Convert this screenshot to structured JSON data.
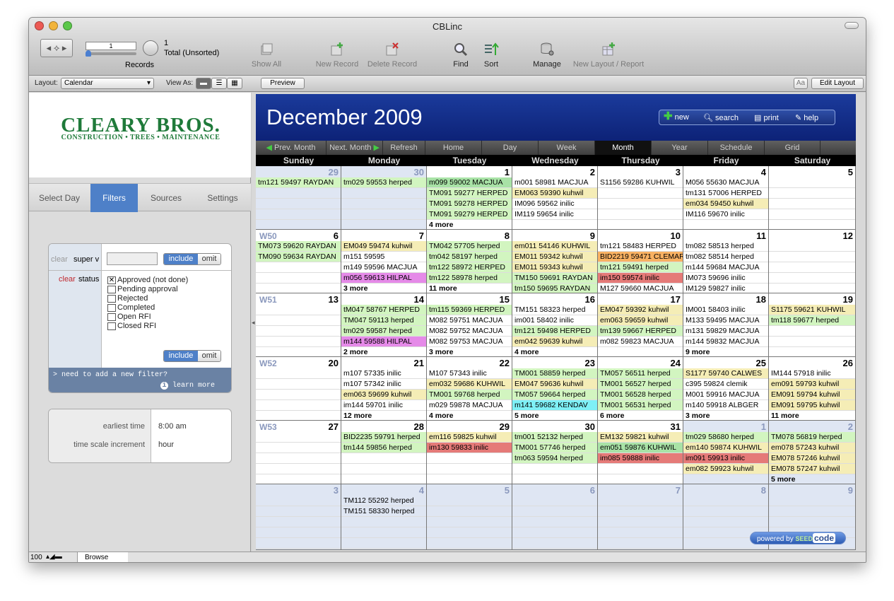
{
  "window": {
    "title": "CBLinc",
    "traffic_lights": [
      "#ec5a54",
      "#f2b43a",
      "#5bc84a"
    ]
  },
  "toolbar": {
    "record_number": "1",
    "found_count": "1",
    "found_label": "Total (Unsorted)",
    "records_label": "Records",
    "show_all": "Show All",
    "new_record": "New Record",
    "delete_record": "Delete Record",
    "find": "Find",
    "sort": "Sort",
    "manage": "Manage",
    "new_layout": "New Layout / Report"
  },
  "layoutbar": {
    "layout_label": "Layout:",
    "layout_value": "Calendar",
    "view_as_label": "View As:",
    "preview": "Preview",
    "aa": "Aa",
    "edit_layout": "Edit Layout"
  },
  "sidebar": {
    "logo_main": "CLEARY BROS.",
    "logo_sub": "CONSTRUCTION • TREES • MAINTENANCE",
    "tabs": [
      "Select Day",
      "Filters",
      "Sources",
      "Settings"
    ],
    "active_tab": "Filters",
    "filter": {
      "clear1": "clear",
      "field1": "super v",
      "clear2": "clear",
      "field2": "status",
      "include": "include",
      "omit": "omit",
      "statuses": [
        "Approved (not done)",
        "Pending approval",
        "Rejected",
        "Completed",
        "Open RFI",
        "Closed RFI"
      ],
      "checked": [
        true,
        false,
        false,
        false,
        false,
        false
      ],
      "need_filter": "> need to add a new filter?",
      "learn_more": "learn more"
    },
    "time": {
      "earliest_label": "earliest time",
      "earliest_value": "8:00 am",
      "scale_label": "time scale increment",
      "scale_value": "hour"
    }
  },
  "statusbar": {
    "zoom": "100",
    "mode": "Browse"
  },
  "calendar": {
    "title": "December 2009",
    "actions": [
      "new",
      "search",
      "print",
      "help"
    ],
    "nav": [
      "Prev. Month",
      "Next. Month",
      "Refresh",
      "Home",
      "Day",
      "Week",
      "Month",
      "Year",
      "Schedule",
      "Grid"
    ],
    "active_view": "Month",
    "weekdays": [
      "Sunday",
      "Monday",
      "Tuesday",
      "Wednesday",
      "Thursday",
      "Friday",
      "Saturday"
    ],
    "weeks": [
      {
        "label": "",
        "days": [
          {
            "n": "29",
            "other": true,
            "ev": [
              [
                "tm121 59497 RAYDAN",
                "g"
              ]
            ]
          },
          {
            "n": "30",
            "other": true,
            "ev": [
              [
                "tm029 59553 herped",
                "g"
              ]
            ]
          },
          {
            "n": "1",
            "ev": [
              [
                "m099 59002 MACJUA",
                "dg"
              ],
              [
                "TM091 59277 HERPED",
                "g"
              ],
              [
                "TM091 59278 HERPED",
                "g"
              ],
              [
                "TM091 59279 HERPED",
                "g"
              ],
              [
                "4 more",
                "m"
              ]
            ]
          },
          {
            "n": "2",
            "ev": [
              [
                "m001 58981 MACJUA",
                ""
              ],
              [
                "EM063 59390 kuhwil",
                "y"
              ],
              [
                "IM096 59562 inilic",
                ""
              ],
              [
                "IM119 59654 inilic",
                ""
              ]
            ]
          },
          {
            "n": "3",
            "ev": [
              [
                "S1156 59286 KUHWIL",
                ""
              ]
            ]
          },
          {
            "n": "4",
            "ev": [
              [
                "M056 55630 MACJUA",
                ""
              ],
              [
                "tm131 57006 HERPED",
                ""
              ],
              [
                "em034 59450 kuhwil",
                "y"
              ],
              [
                "IM116 59670 inilic",
                ""
              ]
            ]
          },
          {
            "n": "5",
            "ev": []
          }
        ]
      },
      {
        "label": "W50",
        "days": [
          {
            "n": "6",
            "ev": [
              [
                "TM073 59620 RAYDAN",
                "g"
              ],
              [
                "TM090 59634 RAYDAN",
                "g"
              ]
            ]
          },
          {
            "n": "7",
            "ev": [
              [
                "EM049 59474 kuhwil",
                "y"
              ],
              [
                "m151 59595",
                ""
              ],
              [
                "m149 59596 MACJUA",
                ""
              ],
              [
                "m056 59613 HILPAL",
                "p"
              ],
              [
                "3 more",
                "m"
              ]
            ]
          },
          {
            "n": "8",
            "ev": [
              [
                "TM042 57705 herped",
                "g"
              ],
              [
                "tm042 58197 herped",
                "g"
              ],
              [
                "tm122 58972 HERPED",
                "g"
              ],
              [
                "tm122 58978 herped",
                "g"
              ],
              [
                "11 more",
                "m"
              ]
            ]
          },
          {
            "n": "9",
            "ev": [
              [
                "em011 54146 KUHWIL",
                "y"
              ],
              [
                "EM011 59342 kuhwil",
                "y"
              ],
              [
                "EM011 59343 kuhwil",
                "y"
              ],
              [
                "TM150 59691 RAYDAN",
                "g"
              ],
              [
                "tm150 59695 RAYDAN",
                "g"
              ]
            ]
          },
          {
            "n": "10",
            "ev": [
              [
                "tm121 58483 HERPED",
                ""
              ],
              [
                "BID2219 59471 CLEMAR",
                "o"
              ],
              [
                "tm121 59491 herped",
                "g"
              ],
              [
                "im150 59574 inilic",
                "r"
              ],
              [
                "M127 59660 MACJUA",
                ""
              ]
            ]
          },
          {
            "n": "11",
            "ev": [
              [
                "tm082 58513 herped",
                ""
              ],
              [
                "tm082 58514 herped",
                ""
              ],
              [
                "m144 59684 MACJUA",
                ""
              ],
              [
                "IM073 59696 inilic",
                ""
              ],
              [
                "IM129 59827 inilic",
                ""
              ]
            ]
          },
          {
            "n": "12",
            "ev": []
          }
        ]
      },
      {
        "label": "W51",
        "days": [
          {
            "n": "13",
            "ev": []
          },
          {
            "n": "14",
            "ev": [
              [
                "tM047 58767 HERPED",
                "g"
              ],
              [
                "TM047 59113 herped",
                "g"
              ],
              [
                "tm029 59587 herped",
                "g"
              ],
              [
                "m144 59588 HILPAL",
                "p"
              ],
              [
                "2 more",
                "m"
              ]
            ]
          },
          {
            "n": "15",
            "ev": [
              [
                "tm115 59369 HERPED",
                "g"
              ],
              [
                "M082 59751 MACJUA",
                ""
              ],
              [
                "M082 59752 MACJUA",
                ""
              ],
              [
                "M082 59753 MACJUA",
                ""
              ],
              [
                "3 more",
                "m"
              ]
            ]
          },
          {
            "n": "16",
            "ev": [
              [
                "TM151 58323 herped",
                ""
              ],
              [
                "im001 58402 inilic",
                ""
              ],
              [
                "tm121 59498 HERPED",
                "g"
              ],
              [
                "em042 59639 kuhwil",
                "y"
              ],
              [
                "4 more",
                "m"
              ]
            ]
          },
          {
            "n": "17",
            "ev": [
              [
                "EM047 59392 kuhwil",
                "y"
              ],
              [
                "em063 59659 kuhwil",
                "y"
              ],
              [
                "tm139 59667 HERPED",
                "g"
              ],
              [
                "m082 59823 MACJUA",
                ""
              ]
            ]
          },
          {
            "n": "18",
            "ev": [
              [
                "IM001 58403 inilic",
                ""
              ],
              [
                "M133 59495 MACJUA",
                ""
              ],
              [
                "m131 59829 MACJUA",
                ""
              ],
              [
                "m144 59832 MACJUA",
                ""
              ],
              [
                "9 more",
                "m"
              ]
            ]
          },
          {
            "n": "19",
            "ev": [
              [
                "S1175 59621 KUHWIL",
                "y"
              ],
              [
                "tm118 59677 herped",
                "g"
              ]
            ]
          }
        ]
      },
      {
        "label": "W52",
        "days": [
          {
            "n": "20",
            "ev": []
          },
          {
            "n": "21",
            "ev": [
              [
                "m107 57335 inilic",
                ""
              ],
              [
                "m107 57342 inilic",
                ""
              ],
              [
                "em063 59699 kuhwil",
                "y"
              ],
              [
                "im144 59701 inilic",
                ""
              ],
              [
                "12 more",
                "m"
              ]
            ]
          },
          {
            "n": "22",
            "ev": [
              [
                "M107 57343 inilic",
                ""
              ],
              [
                "em032 59686 KUHWIL",
                "y"
              ],
              [
                "TM001 59768 herped",
                "g"
              ],
              [
                "m029 59878 MACJUA",
                ""
              ],
              [
                "4 more",
                "m"
              ]
            ]
          },
          {
            "n": "23",
            "ev": [
              [
                "TM001 58859 herped",
                "g"
              ],
              [
                "EM047 59636 kuhwil",
                "y"
              ],
              [
                "TM057 59664 herped",
                "g"
              ],
              [
                "m141 59682 KENDAV",
                "c"
              ],
              [
                "5 more",
                "m"
              ]
            ]
          },
          {
            "n": "24",
            "ev": [
              [
                "TM057 56511 herped",
                "g"
              ],
              [
                "TM001 56527 herped",
                "g"
              ],
              [
                "TM001 56528 herped",
                "g"
              ],
              [
                "TM001 56531 herped",
                "g"
              ],
              [
                "6 more",
                "m"
              ]
            ]
          },
          {
            "n": "25",
            "ev": [
              [
                "S1177 59740 CALWES",
                "y"
              ],
              [
                "c395 59824 clemik",
                ""
              ],
              [
                "M001 59916 MACJUA",
                ""
              ],
              [
                "m140 59918 ALBGER",
                ""
              ],
              [
                "3 more",
                "m"
              ]
            ]
          },
          {
            "n": "26",
            "ev": [
              [
                "IM144 57918 inilic",
                ""
              ],
              [
                "em091 59793 kuhwil",
                "y"
              ],
              [
                "EM091 59794 kuhwil",
                "y"
              ],
              [
                "EM091 59795 kuhwil",
                "y"
              ],
              [
                "11 more",
                "m"
              ]
            ]
          }
        ]
      },
      {
        "label": "W53",
        "days": [
          {
            "n": "27",
            "ev": []
          },
          {
            "n": "28",
            "ev": [
              [
                "BID2235 59791 herped",
                "g"
              ],
              [
                "tm144 59856 herped",
                "g"
              ]
            ]
          },
          {
            "n": "29",
            "ev": [
              [
                "em116 59825 kuhwil",
                "y"
              ],
              [
                "im130 59833 inilic",
                "r"
              ]
            ]
          },
          {
            "n": "30",
            "ev": [
              [
                "tm001 52132 herped",
                "g"
              ],
              [
                "TM001 57746 herped",
                "g"
              ],
              [
                "tm063 59594 herped",
                "g"
              ]
            ]
          },
          {
            "n": "31",
            "ev": [
              [
                "EM132 59821 kuhwil",
                "y"
              ],
              [
                "em051 59876 KUHWIL",
                "dg"
              ],
              [
                "im085 59888 inilic",
                "r"
              ]
            ]
          },
          {
            "n": "1",
            "other": true,
            "ev": [
              [
                "tm029 58680 herped",
                "g"
              ],
              [
                "em140 59874 KUHWIL",
                "y"
              ],
              [
                "im091 59913 inilic",
                "r"
              ],
              [
                "em082 59923 kuhwil",
                "y"
              ]
            ]
          },
          {
            "n": "2",
            "other": true,
            "ev": [
              [
                "TM078 56819 herped",
                "g"
              ],
              [
                "em078 57243 kuhwil",
                "y"
              ],
              [
                "EM078 57246 kuhwil",
                "y"
              ],
              [
                "EM078 57247 kuhwil",
                "y"
              ],
              [
                "5 more",
                "m"
              ]
            ]
          }
        ]
      },
      {
        "label": "",
        "days": [
          {
            "n": "3",
            "other": true,
            "ev": []
          },
          {
            "n": "4",
            "other": true,
            "ev": [
              [
                "TM112 55292 herped",
                ""
              ],
              [
                "TM151 58330 herped",
                ""
              ]
            ]
          },
          {
            "n": "5",
            "other": true,
            "ev": []
          },
          {
            "n": "6",
            "other": true,
            "ev": []
          },
          {
            "n": "7",
            "other": true,
            "ev": []
          },
          {
            "n": "8",
            "other": true,
            "ev": []
          },
          {
            "n": "9",
            "other": true,
            "ev": []
          }
        ]
      }
    ],
    "colors": {
      "g": "#d2f5c0",
      "dg": "#a8e2a6",
      "y": "#f5edb6",
      "p": "#e58ae8",
      "r": "#e57a78",
      "o": "#f8b162",
      "c": "#7ef0f6",
      "m": "transparent"
    },
    "powered_by": "powered by",
    "seed": "SEED",
    "code": "code"
  }
}
